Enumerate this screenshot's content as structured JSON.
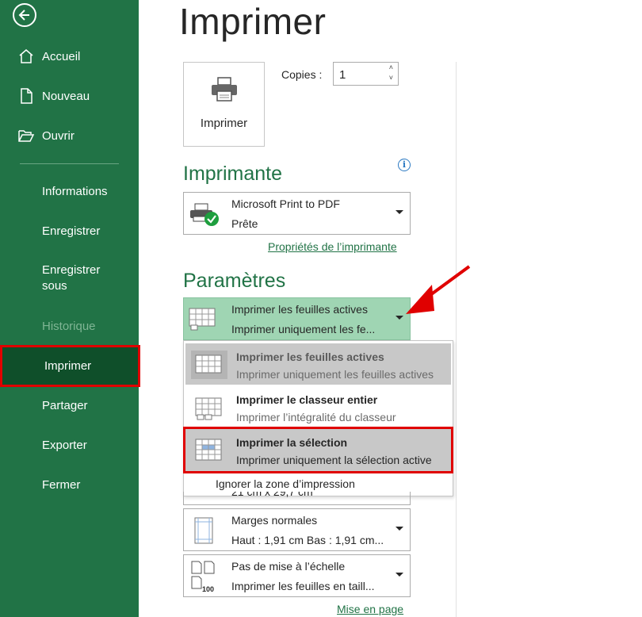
{
  "sidebar": {
    "back_icon": "back-arrow-icon",
    "items": [
      {
        "label": "Accueil",
        "icon": "home-icon"
      },
      {
        "label": "Nouveau",
        "icon": "new-document-icon"
      },
      {
        "label": "Ouvrir",
        "icon": "folder-open-icon"
      },
      {
        "label": "Informations"
      },
      {
        "label": "Enregistrer"
      },
      {
        "label": "Enregistrer sous"
      },
      {
        "label": "Historique"
      },
      {
        "label": "Imprimer"
      },
      {
        "label": "Partager"
      },
      {
        "label": "Exporter"
      },
      {
        "label": "Fermer"
      }
    ]
  },
  "main": {
    "title": "Imprimer",
    "print_button": "Imprimer",
    "copies_label": "Copies :",
    "copies_value": "1"
  },
  "printer": {
    "heading": "Imprimante",
    "name": "Microsoft Print to PDF",
    "status": "Prête",
    "properties_link": "Propriétés de l’imprimante"
  },
  "settings": {
    "heading": "Paramètres",
    "selected_line1": "Imprimer les feuilles actives",
    "selected_line2": "Imprimer uniquement les fe...",
    "menu": [
      {
        "title": "Imprimer les feuilles actives",
        "desc": "Imprimer uniquement les feuilles actives"
      },
      {
        "title": "Imprimer le classeur entier",
        "desc": "Imprimer l’intégralité du classeur"
      },
      {
        "title": "Imprimer la sélection",
        "desc": "Imprimer uniquement la sélection active"
      }
    ],
    "ignore_print_area": "Ignorer la zone d’impression",
    "partial_text": "21 cm x 29,7 cm",
    "margins_line1": "Marges normales",
    "margins_line2": "Haut : 1,91 cm Bas : 1,91 cm...",
    "scaling_line1": "Pas de mise à l’échelle",
    "scaling_line2": "Imprimer les feuilles en taill...",
    "page_setup_link": "Mise en page"
  },
  "colors": {
    "sidebar": "#217346",
    "active": "#0f4f2a",
    "highlight_red": "#e00000"
  }
}
